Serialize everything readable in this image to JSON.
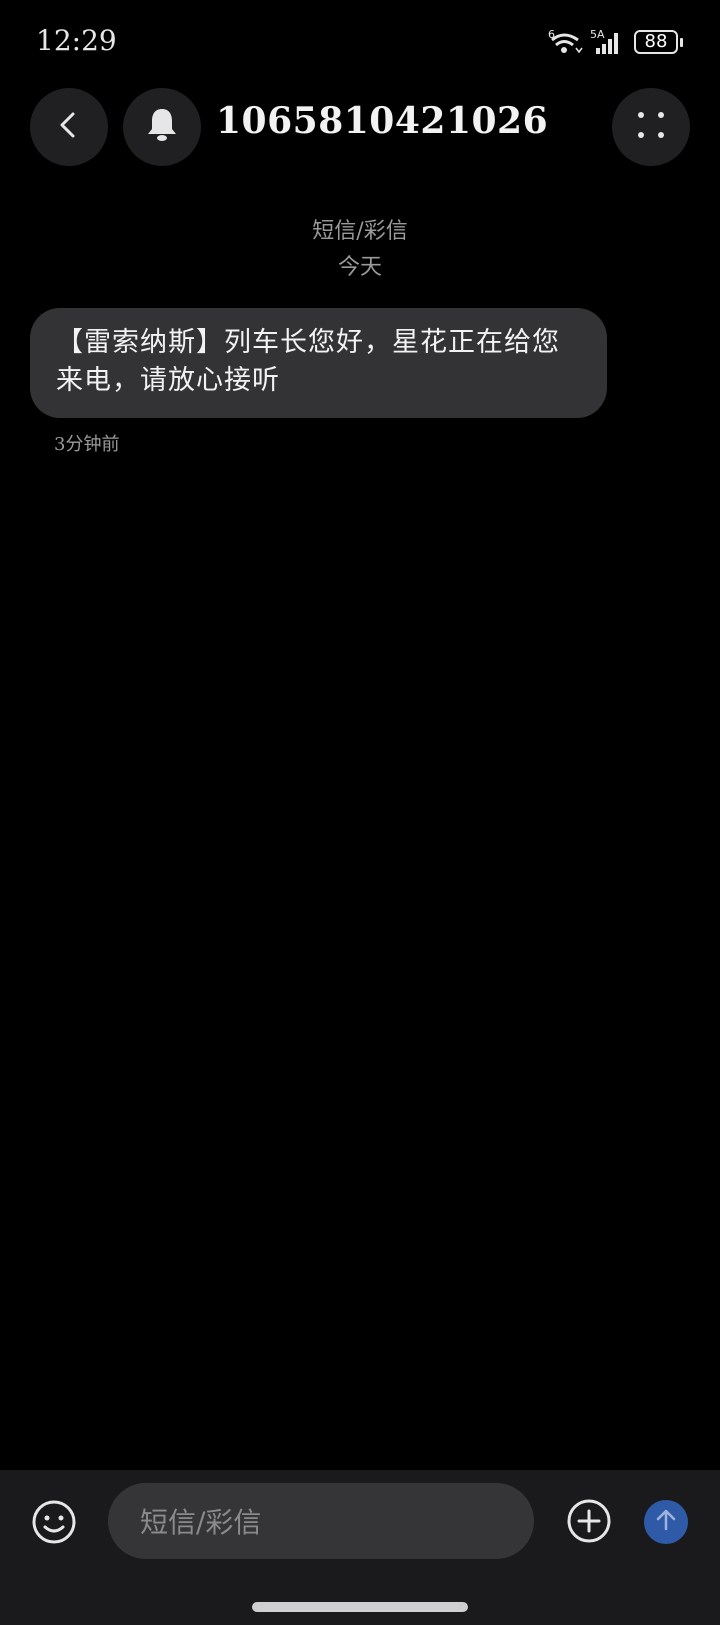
{
  "status_bar": {
    "time": "12:29",
    "wifi_label": "6",
    "network_label": "5A",
    "battery": "88"
  },
  "header": {
    "contact": "1065810421026",
    "icons": {
      "back": "chevron-left-icon",
      "bell": "bell-icon",
      "more": "more-dots-icon"
    }
  },
  "conversation": {
    "type_label": "短信/彩信",
    "date_label": "今天",
    "messages": [
      {
        "text": "【雷索纳斯】列车长您好，星花正在给您来电，请放心接听",
        "time": "3分钟前"
      }
    ]
  },
  "composer": {
    "placeholder": "短信/彩信",
    "icons": {
      "emoji": "emoji-icon",
      "add": "plus-circle-icon",
      "send": "send-arrow-icon"
    },
    "send_color": "#2e5aa8"
  }
}
